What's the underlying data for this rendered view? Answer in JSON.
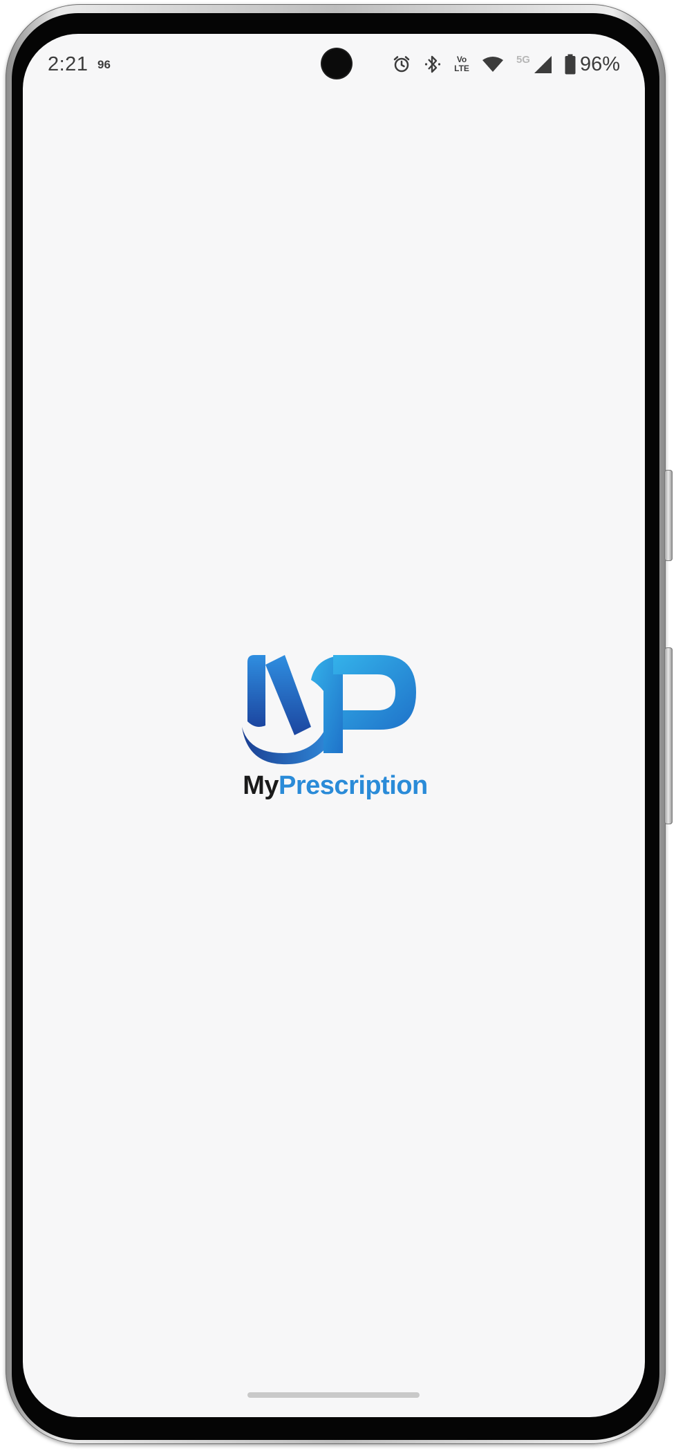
{
  "status_bar": {
    "time": "2:21",
    "notification_badge": "96",
    "voLTE_top": "Vo",
    "voLTE_bottom": "LTE",
    "network_label": "5G",
    "battery_percent": "96%",
    "icons": [
      "alarm-icon",
      "bluetooth-icon",
      "volte-icon",
      "wifi-icon",
      "signal-icon",
      "battery-icon"
    ]
  },
  "splash": {
    "logo_text_dark": "My",
    "logo_text_accent": "Prescription",
    "colors": {
      "dark_text": "#1a1a1a",
      "accent_text": "#2a8bd8",
      "mark_dark_blue": "#1f4fa8",
      "mark_light_blue": "#2fa5e6"
    }
  }
}
